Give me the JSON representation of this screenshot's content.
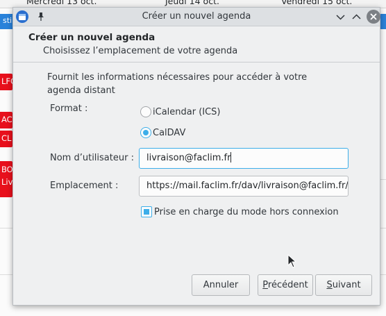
{
  "calendar": {
    "days": [
      "Mercredi 13 oct.",
      "Jeudi 14 oct.",
      "Vendredi 15 oct."
    ],
    "selected_label": "sti",
    "events": [
      "LFC",
      "AC",
      "CL",
      "BO",
      "Liv"
    ]
  },
  "window": {
    "title": "Créer un nouvel agenda",
    "icons": {
      "app": "calendar-app-icon",
      "pin": "pin-icon",
      "minimize": "chevron-down-icon",
      "maximize": "chevron-up-icon",
      "close": "close-icon"
    }
  },
  "header": {
    "title": "Créer un nouvel agenda",
    "subtitle": "Choisissez l’emplacement de votre agenda"
  },
  "form": {
    "intro": "Fournit les informations nécessaires pour accéder à votre agenda distant",
    "format_label": "Format :",
    "format_options": [
      {
        "label": "iCalendar (ICS)",
        "selected": false
      },
      {
        "label": "CalDAV",
        "selected": true
      }
    ],
    "username_label": "Nom d’utilisateur :",
    "username_value": "livraison@faclim.fr",
    "location_label": "Emplacement :",
    "location_value": "https://mail.faclim.fr/dav/livraison@faclim.fr/",
    "offline_label": "Prise en charge du mode hors connexion",
    "offline_checked": true
  },
  "buttons": {
    "cancel": "Annuler",
    "previous_prefix": "",
    "previous_mnemonic": "P",
    "previous_rest": "récédent",
    "next_mnemonic": "S",
    "next_rest": "uivant"
  },
  "colors": {
    "accent": "#3daee9",
    "event_red": "#e8101c",
    "selection_blue": "#2a82da"
  }
}
